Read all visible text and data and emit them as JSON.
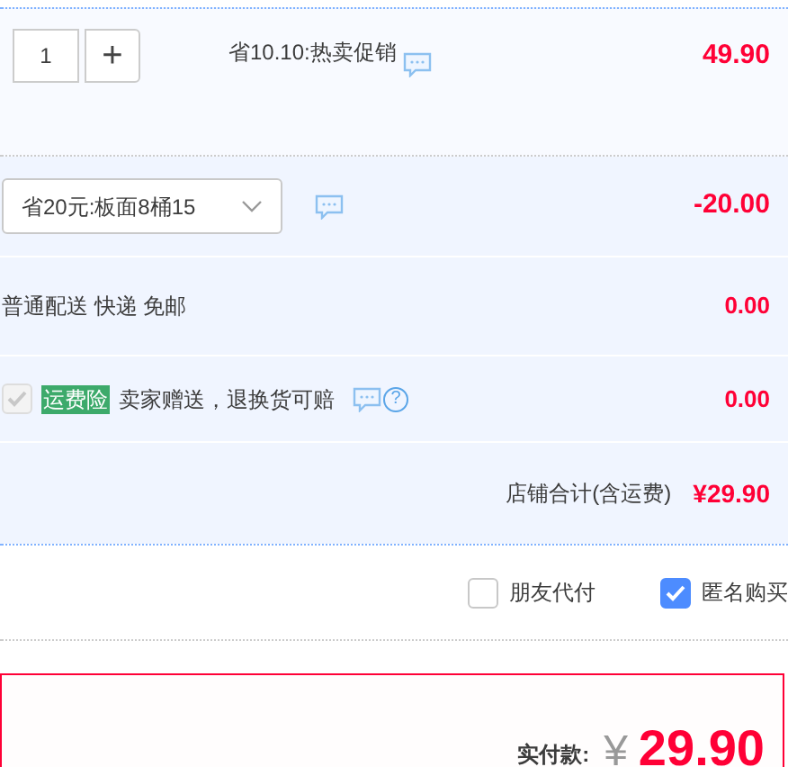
{
  "item": {
    "quantity": "1",
    "plus": "+",
    "promo": "省10.10:热卖促销",
    "price": "49.90"
  },
  "coupon": {
    "value": "省20元:板面8桶15",
    "amount": "-20.00"
  },
  "shipping": {
    "label": "普通配送 快递 免邮",
    "amount": "0.00"
  },
  "insurance": {
    "checked": true,
    "disabled": true,
    "tag": "运费险",
    "text": "卖家赠送，退换货可赔",
    "help": "?",
    "amount": "0.00"
  },
  "store_total": {
    "label": "店铺合计(含运费)",
    "amount": "¥29.90"
  },
  "options": [
    {
      "label": "朋友代付",
      "checked": false
    },
    {
      "label": "匿名购买",
      "checked": true
    }
  ],
  "payment": {
    "label": "实付款:",
    "currency": "¥",
    "amount": "29.90"
  }
}
